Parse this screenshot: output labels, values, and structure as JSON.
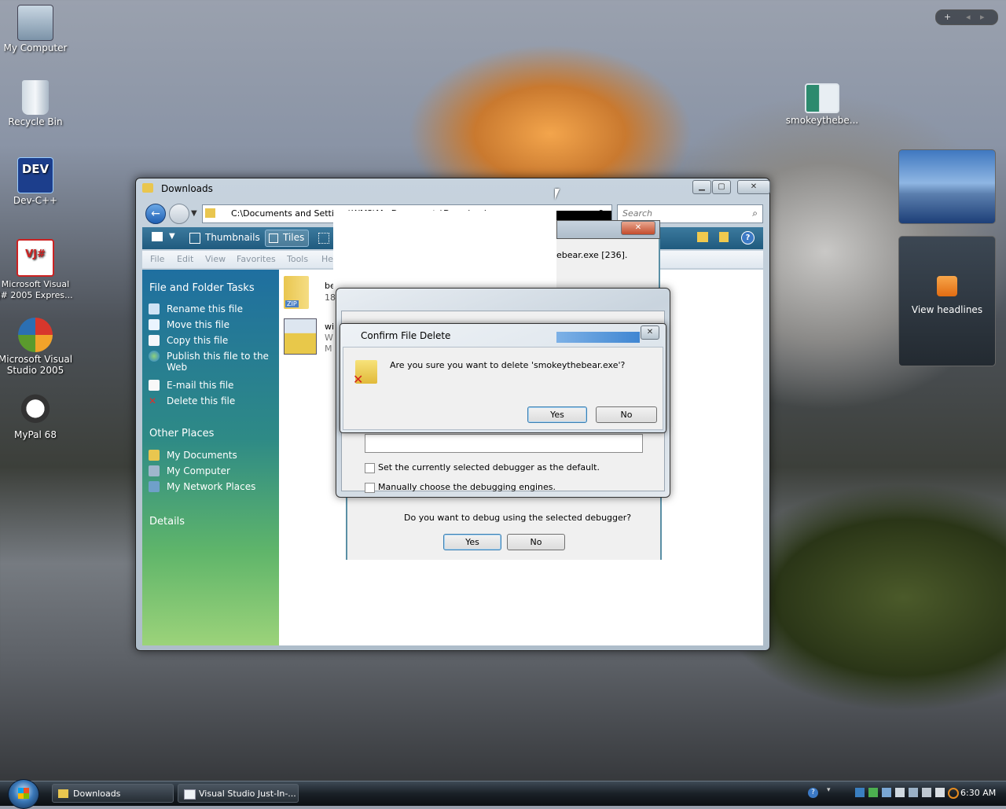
{
  "desktop": {
    "icons": [
      {
        "label": "My Computer"
      },
      {
        "label": "Recycle Bin"
      },
      {
        "label": "Dev-C++",
        "badge": "DEV"
      },
      {
        "label": "Microsoft Visual J# 2005 Expres...",
        "badge": "VJ#"
      },
      {
        "label": "Microsoft Visual Studio 2005"
      },
      {
        "label": "MyPal 68"
      },
      {
        "label": "smokeythebe..."
      }
    ]
  },
  "sidebar_gadget": {
    "controls": [
      "+",
      "◂",
      "▸"
    ],
    "feed_label": "View headlines"
  },
  "explorer": {
    "title": "Downloads",
    "address": "C:\\Documents and Settir    \\WM2\\My Documents\\Downloads",
    "search_placeholder": "Search",
    "toolbar": {
      "thumbnails": "Thumbnails",
      "tiles": "Tiles"
    },
    "menu": [
      "File",
      "Edit",
      "View",
      "Favorites",
      "Tools",
      "He"
    ],
    "file_tasks": {
      "heading": "File and Folder Tasks",
      "items": [
        "Rename this file",
        "Move this file",
        "Copy this file",
        "Publish this file to the Web",
        "E-mail this file",
        "Delete this file"
      ]
    },
    "other_places": {
      "heading": "Other Places",
      "items": [
        "My Documents",
        "My Computer",
        "My Network Places"
      ]
    },
    "details_heading": "Details",
    "files": [
      {
        "name": "be",
        "line2": "18",
        "type": "ZIP"
      },
      {
        "name": "wi",
        "line2": "W",
        "line3": "M"
      }
    ]
  },
  "jit_debugger": {
    "partial_text": "ebear.exe [236].",
    "checkbox_default": "Set the currently selected debugger as the default.",
    "checkbox_manual": "Manually choose the debugging engines.",
    "question": "Do you want to debug using the selected debugger?",
    "yes": "Yes",
    "no": "No"
  },
  "confirm_delete": {
    "title": "Confirm File Delete",
    "message": "Are you sure you want to delete 'smokeythebear.exe'?",
    "yes": "Yes",
    "no": "No",
    "close": "✕"
  },
  "taskbar": {
    "buttons": [
      "Downloads",
      "Visual Studio Just-In-..."
    ],
    "clock": "6:30 AM"
  },
  "colors": {
    "accent": "#1f5a7e",
    "explorer_sidebar": "#2e8a86",
    "tile_sky": "#3f78c0"
  }
}
